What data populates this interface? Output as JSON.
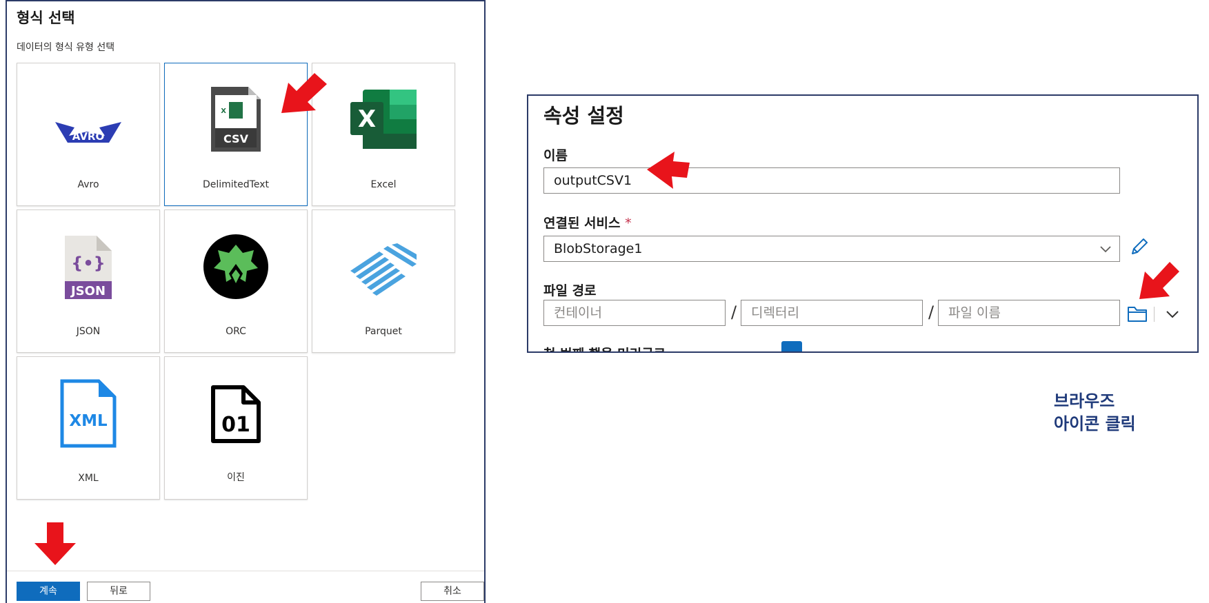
{
  "format_dialog": {
    "title": "형식 선택",
    "subtitle": "데이터의 형식 유형 선택",
    "tiles": [
      {
        "label": "Avro",
        "icon": "avro-logo-icon"
      },
      {
        "label": "DelimitedText",
        "icon": "csv-file-icon",
        "selected": true
      },
      {
        "label": "Excel",
        "icon": "excel-icon"
      },
      {
        "label": "JSON",
        "icon": "json-file-icon"
      },
      {
        "label": "ORC",
        "icon": "orc-logo-icon"
      },
      {
        "label": "Parquet",
        "icon": "parquet-logo-icon"
      },
      {
        "label": "XML",
        "icon": "xml-file-icon"
      },
      {
        "label": "이진",
        "icon": "binary-file-icon"
      }
    ],
    "icon_text": {
      "avro": "AVRO",
      "csv_badge": "CSV",
      "csv_mini": "X",
      "excel": "X",
      "json_braces": "{•}",
      "json_badge": "JSON",
      "xml": "XML",
      "binary": "01"
    },
    "buttons": {
      "continue": "계속",
      "back": "뒤로",
      "cancel": "취소"
    }
  },
  "properties_panel": {
    "title": "속성 설정",
    "name_label": "이름",
    "name_value": "outputCSV1",
    "linked_service_label": "연결된 서비스",
    "required_marker": "*",
    "linked_service_value": "BlobStorage1",
    "file_path_label": "파일 경로",
    "container_placeholder": "컨테이너",
    "directory_placeholder": "디렉터리",
    "filename_placeholder": "파일 이름",
    "path_separator": "/",
    "first_row_label": "첫 번째 행을 머리글로"
  },
  "annotation": {
    "line1": "브라우즈",
    "line2": "아이콘 클릭"
  },
  "colors": {
    "accent": "#0f6cbd",
    "arrow": "#e8141b",
    "panel_border": "#2b3a67",
    "note_text": "#1f3a7a"
  }
}
